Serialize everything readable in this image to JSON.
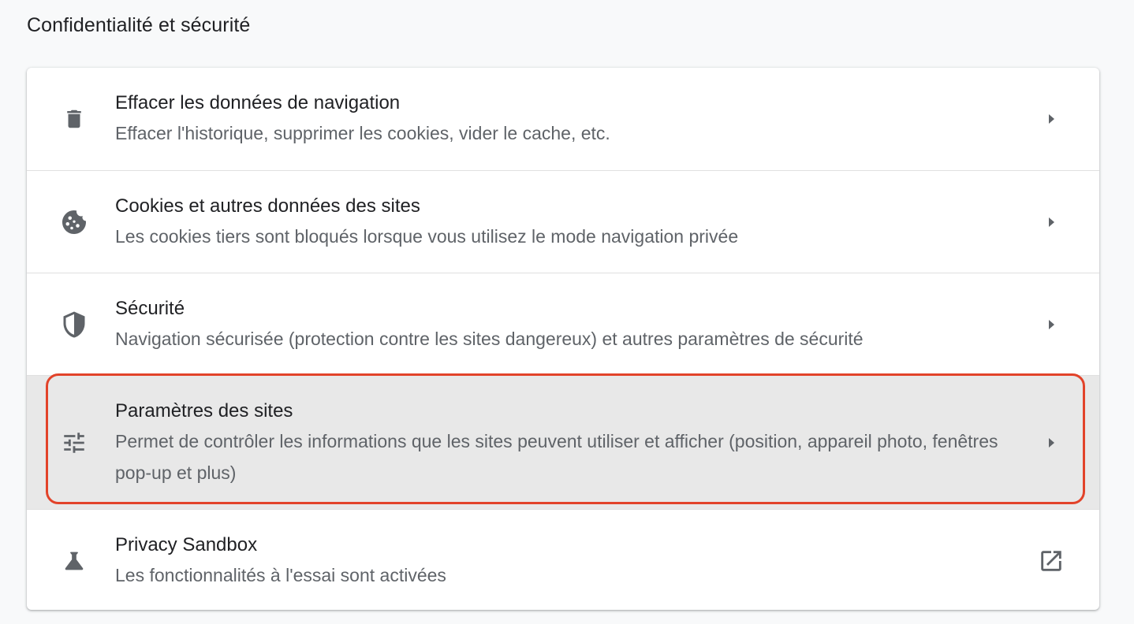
{
  "section": {
    "title": "Confidentialité et sécurité"
  },
  "rows": [
    {
      "label": "Effacer les données de navigation",
      "sublabel": "Effacer l'historique, supprimer les cookies, vider le cache, etc.",
      "icon": "trash-icon",
      "trailing_icon": "arrow-right-icon"
    },
    {
      "label": "Cookies et autres données des sites",
      "sublabel": "Les cookies tiers sont bloqués lorsque vous utilisez le mode navigation privée",
      "icon": "cookie-icon",
      "trailing_icon": "arrow-right-icon"
    },
    {
      "label": "Sécurité",
      "sublabel": "Navigation sécurisée (protection contre les sites dangereux) et autres paramètres de sécurité",
      "icon": "shield-icon",
      "trailing_icon": "arrow-right-icon"
    },
    {
      "label": "Paramètres des sites",
      "sublabel": "Permet de contrôler les informations que les sites peuvent utiliser et afficher (position, appareil photo, fenêtres pop-up et plus)",
      "icon": "tune-icon",
      "trailing_icon": "arrow-right-icon",
      "highlighted": true
    },
    {
      "label": "Privacy Sandbox",
      "sublabel": "Les fonctionnalités à l'essai sont activées",
      "icon": "flask-icon",
      "trailing_icon": "open-in-new-icon"
    }
  ],
  "colors": {
    "page_background": "#f8f9fa",
    "card_background": "#ffffff",
    "highlight_row_background": "#e8e8e8",
    "highlight_frame": "#e2432a",
    "icon": "#5f6368",
    "primary_text": "#202124",
    "secondary_text": "#5f6368"
  }
}
